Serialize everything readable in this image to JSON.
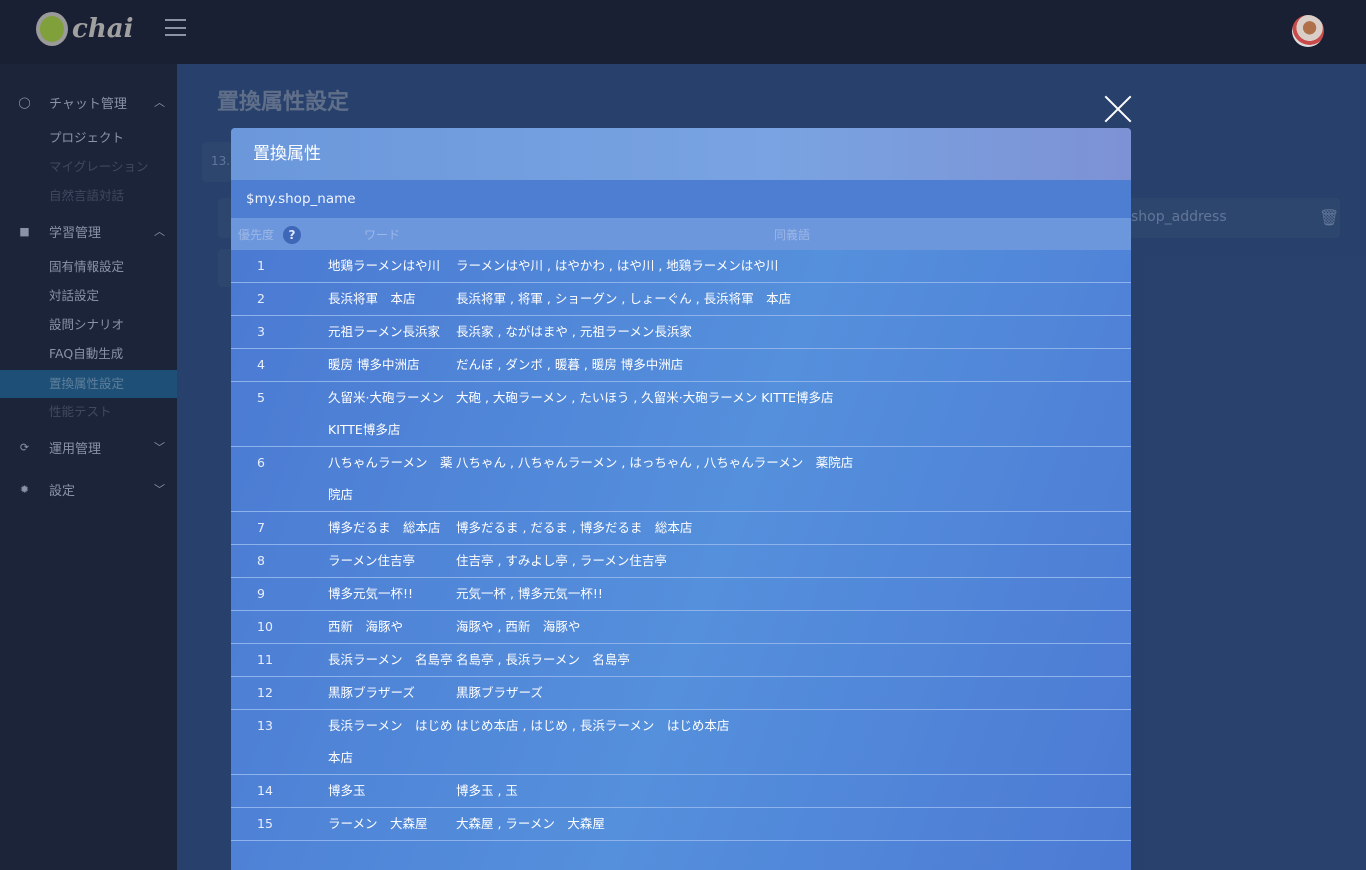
{
  "app": {
    "logo_text": "chai",
    "avatar": "user-avatar"
  },
  "sidebar": {
    "sections": [
      {
        "label": "チャット管理",
        "icon": "chat-bubble-icon",
        "expanded": true,
        "items": [
          {
            "label": "プロジェクト",
            "state": "normal"
          },
          {
            "label": "マイグレーション",
            "state": "disabled"
          },
          {
            "label": "自然言語対話",
            "state": "disabled"
          }
        ]
      },
      {
        "label": "学習管理",
        "icon": "bookmark-icon",
        "expanded": true,
        "items": [
          {
            "label": "固有情報設定",
            "state": "normal"
          },
          {
            "label": "対話設定",
            "state": "normal"
          },
          {
            "label": "設問シナリオ",
            "state": "normal"
          },
          {
            "label": "FAQ自動生成",
            "state": "normal"
          },
          {
            "label": "置換属性設定",
            "state": "active"
          },
          {
            "label": "性能テスト",
            "state": "disabled"
          }
        ]
      },
      {
        "label": "運用管理",
        "icon": "sync-icon",
        "expanded": false
      },
      {
        "label": "設定",
        "icon": "gear-icon",
        "expanded": false
      }
    ]
  },
  "page": {
    "title": "置換属性設定",
    "bg_row_number": "13.",
    "bg_field_value": "shop_address"
  },
  "modal": {
    "title": "置換属性",
    "variable": "$my.shop_name",
    "columns": {
      "priority": "優先度",
      "help": "?",
      "word": "ワード",
      "synonyms": "同義語"
    },
    "rows": [
      {
        "rank": "1",
        "word": "地鶏ラーメンはや川",
        "synonyms": "ラーメンはや川 , はやかわ , はや川 , 地鶏ラーメンはや川"
      },
      {
        "rank": "2",
        "word": "長浜将軍　本店",
        "synonyms": "長浜将軍 , 将軍 , ショーグン , しょーぐん , 長浜将軍　本店"
      },
      {
        "rank": "3",
        "word": "元祖ラーメン長浜家",
        "synonyms": "長浜家 , ながはまや , 元祖ラーメン長浜家"
      },
      {
        "rank": "4",
        "word": "暖房 博多中洲店",
        "synonyms": "だんぼ , ダンボ , 暖暮 , 暖房 博多中洲店"
      },
      {
        "rank": "5",
        "word": "久留米·大砲ラーメン KITTE博多店",
        "synonyms": "大砲 , 大砲ラーメン , たいほう , 久留米·大砲ラーメン KITTE博多店"
      },
      {
        "rank": "6",
        "word": "八ちゃんラーメン　薬院店",
        "synonyms": "八ちゃん , 八ちゃんラーメン , はっちゃん , 八ちゃんラーメン　薬院店"
      },
      {
        "rank": "7",
        "word": "博多だるま　総本店",
        "synonyms": "博多だるま , だるま , 博多だるま　総本店"
      },
      {
        "rank": "8",
        "word": "ラーメン住吉亭",
        "synonyms": "住吉亭 , すみよし亭 , ラーメン住吉亭"
      },
      {
        "rank": "9",
        "word": "博多元気一杯!!",
        "synonyms": "元気一杯 , 博多元気一杯!!"
      },
      {
        "rank": "10",
        "word": "西新　海豚や",
        "synonyms": "海豚や , 西新　海豚や"
      },
      {
        "rank": "11",
        "word": "長浜ラーメン　名島亭",
        "synonyms": "名島亭 , 長浜ラーメン　名島亭"
      },
      {
        "rank": "12",
        "word": "黒豚ブラザーズ",
        "synonyms": "黒豚ブラザーズ"
      },
      {
        "rank": "13",
        "word": "長浜ラーメン　はじめ本店",
        "synonyms": "はじめ本店 , はじめ , 長浜ラーメン　はじめ本店"
      },
      {
        "rank": "14",
        "word": "博多玉",
        "synonyms": "博多玉 , 玉"
      },
      {
        "rank": "15",
        "word": "ラーメン　大森屋",
        "synonyms": "大森屋 , ラーメン　大森屋"
      }
    ]
  }
}
